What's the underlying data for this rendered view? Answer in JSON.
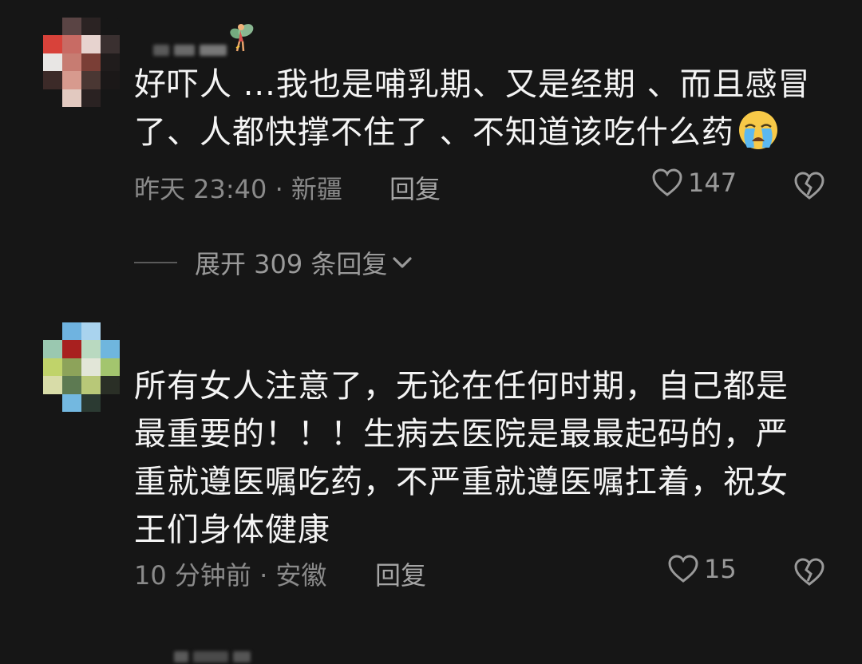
{
  "comments": [
    {
      "text_lines": [
        "好吓人 ...我也是哺乳期、又是经期 、而且感冒",
        "了、人都快撑不住了 、不知道该吃什么药"
      ],
      "emoji": "loudly-crying-face-icon",
      "time": "昨天 23:40",
      "location": "新疆",
      "reply_label": "回复",
      "likes": "147"
    },
    {
      "text_lines": [
        "所有女人注意了，无论在任何时期，自己都是",
        "最重要的！！！生病去医院是最最起码的，严",
        "重就遵医嘱吃药，不严重就遵医嘱扛着，祝女",
        "王们身体健康"
      ],
      "time": "10 分钟前",
      "location": "安徽",
      "reply_label": "回复",
      "likes": "15"
    }
  ],
  "expand_replies": {
    "label": "展开 309 条回复",
    "icon": "chevron-down-icon"
  },
  "colors": {
    "background": "#161616",
    "text": "#f4f4f4",
    "meta": "#8a8a8a",
    "icon": "#9a9a9a"
  }
}
